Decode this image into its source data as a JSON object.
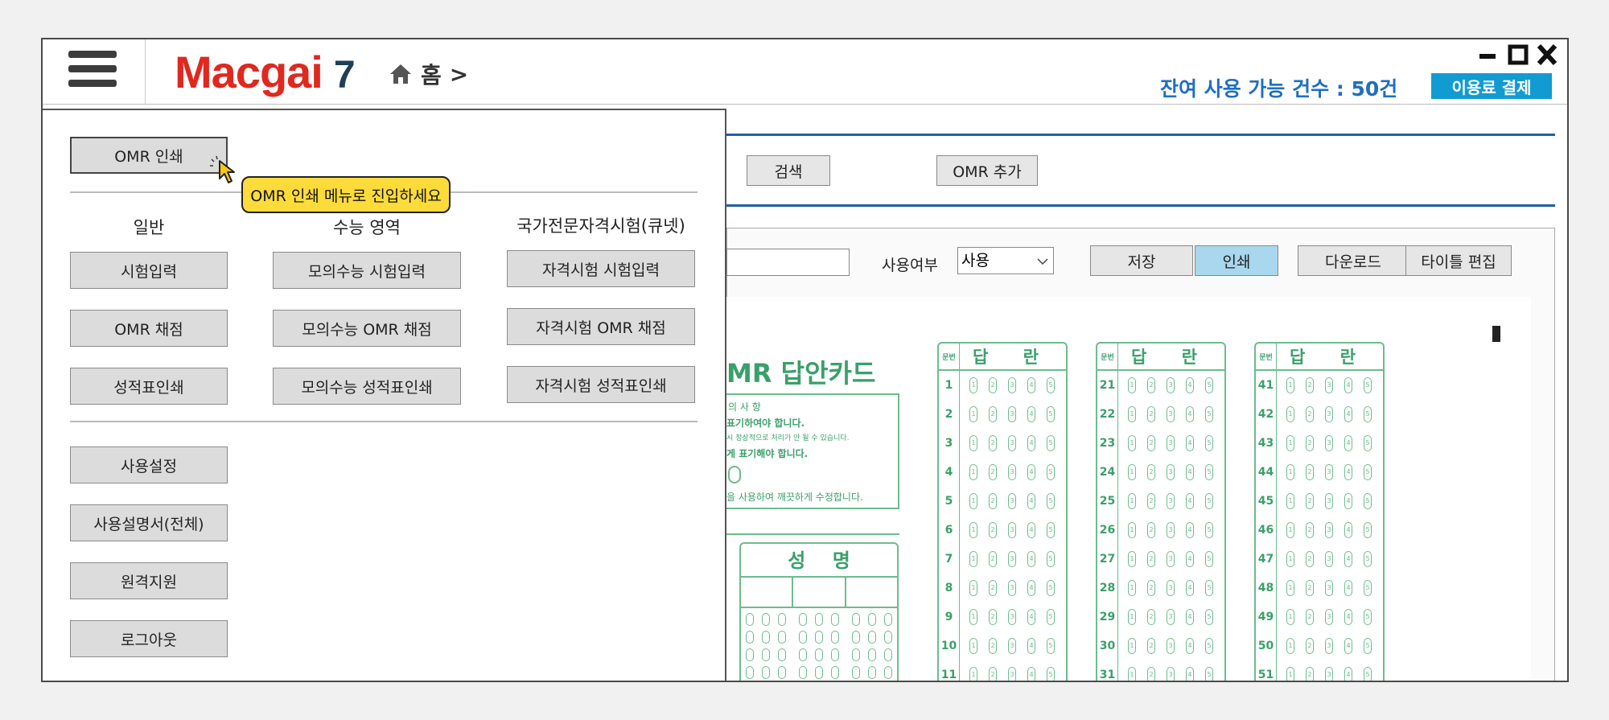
{
  "header": {
    "logo_main": "Macgai",
    "logo_num": "7",
    "home_label": "홈",
    "breadcrumb_arrow": ">",
    "remaining": "잔여 사용 가능 건수 : 50건",
    "pay_button": "이용료 결제",
    "icons": [
      "hamburger-icon",
      "home-icon",
      "minimize-icon",
      "maximize-icon",
      "close-icon"
    ]
  },
  "toolbar": {
    "search_button": "검색",
    "add_omr_button": "OMR 추가"
  },
  "form": {
    "name_value": "",
    "use_label": "사용여부",
    "use_value": "사용",
    "save_button": "저장",
    "print_button": "인쇄",
    "download_button": "다운로드",
    "title_edit_button": "타이틀 편집"
  },
  "menu": {
    "top_button": "OMR 인쇄",
    "tooltip": "OMR 인쇄 메뉴로 진입하세요",
    "columns": [
      {
        "heading": "일반",
        "items": [
          "시험입력",
          "OMR 채점",
          "성적표인쇄"
        ]
      },
      {
        "heading": "수능 영역",
        "items": [
          "모의수능 시험입력",
          "모의수능 OMR 채점",
          "모의수능 성적표인쇄"
        ]
      },
      {
        "heading": "국가전문자격시험(큐넷)",
        "items": [
          "자격시험 시험입력",
          "자격시험 OMR 채점",
          "자격시험 성적표인쇄"
        ]
      }
    ],
    "bottom_items": [
      "사용설정",
      "사용설명서(전체)",
      "원격지원",
      "로그아웃"
    ]
  },
  "omr": {
    "title": "MR 답안카드",
    "notice_title": "의 사 항",
    "notice_lines": [
      "표기하여야 합니다.",
      "시 정상적으로 처리가 안 될 수 있습니다.",
      "게 표기해야 합니다.",
      "을 사용하여 깨끗하게 수정합니다."
    ],
    "name_label": "성    명",
    "col_no_label": "문번",
    "col_label": "답 란",
    "columns": [
      {
        "numbers": [
          "1",
          "2",
          "3",
          "4",
          "5",
          "6",
          "7",
          "8",
          "9",
          "10",
          "11"
        ]
      },
      {
        "numbers": [
          "21",
          "22",
          "23",
          "24",
          "25",
          "26",
          "27",
          "28",
          "29",
          "30",
          "31"
        ]
      },
      {
        "numbers": [
          "41",
          "42",
          "43",
          "44",
          "45",
          "46",
          "47",
          "48",
          "49",
          "50",
          "51"
        ]
      }
    ],
    "bubble_labels": [
      "1",
      "2",
      "3",
      "4",
      "5"
    ]
  },
  "colors": {
    "accent": "#129bd2",
    "logo_red": "#e0281f",
    "tooltip": "#fddb3a",
    "omr_green": "#3aa06a"
  }
}
